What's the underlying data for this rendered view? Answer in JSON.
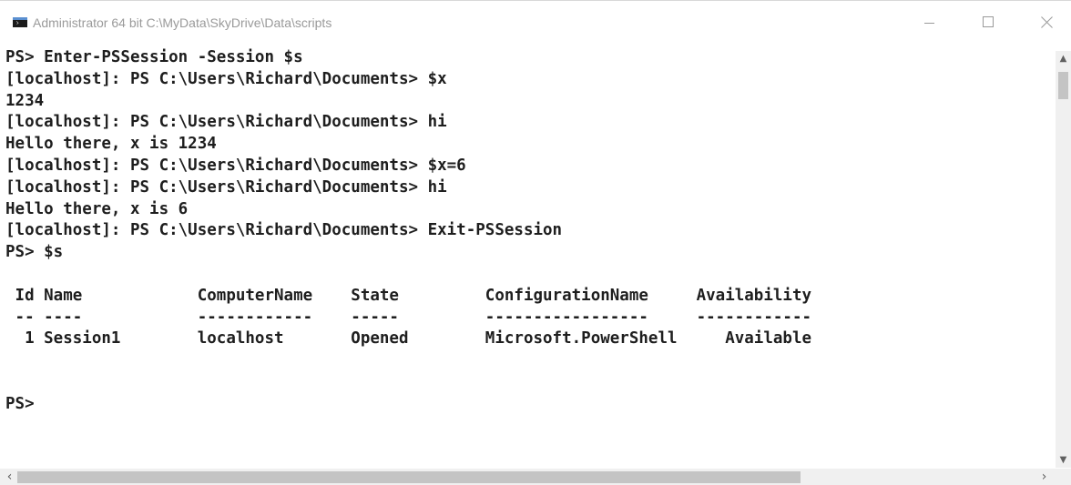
{
  "window": {
    "title": "Administrator 64 bit C:\\MyData\\SkyDrive\\Data\\scripts",
    "controls": {
      "minimize": "minimize-icon",
      "maximize": "maximize-icon",
      "close": "close-icon"
    }
  },
  "console": {
    "lines": [
      "PS> Enter-PSSession -Session $s",
      "[localhost]: PS C:\\Users\\Richard\\Documents> $x",
      "1234",
      "[localhost]: PS C:\\Users\\Richard\\Documents> hi",
      "Hello there, x is 1234",
      "[localhost]: PS C:\\Users\\Richard\\Documents> $x=6",
      "[localhost]: PS C:\\Users\\Richard\\Documents> hi",
      "Hello there, x is 6",
      "[localhost]: PS C:\\Users\\Richard\\Documents> Exit-PSSession",
      "PS> $s",
      "",
      " Id Name            ComputerName    State         ConfigurationName     Availability",
      " -- ----            ------------    -----         -----------------     ------------",
      "  1 Session1        localhost       Opened        Microsoft.PowerShell     Available",
      "",
      "",
      "PS>"
    ]
  },
  "scrollbars": {
    "vertical_up": "▲",
    "vertical_down": "▼",
    "horizontal_left": "‹",
    "horizontal_right": "›"
  },
  "colors": {
    "background": "#ffffff",
    "text": "#1e1e1e",
    "title_text": "#9a9a9a",
    "scrollbar_track": "#f0f0f0",
    "scrollbar_thumb": "#c4c4c4"
  }
}
